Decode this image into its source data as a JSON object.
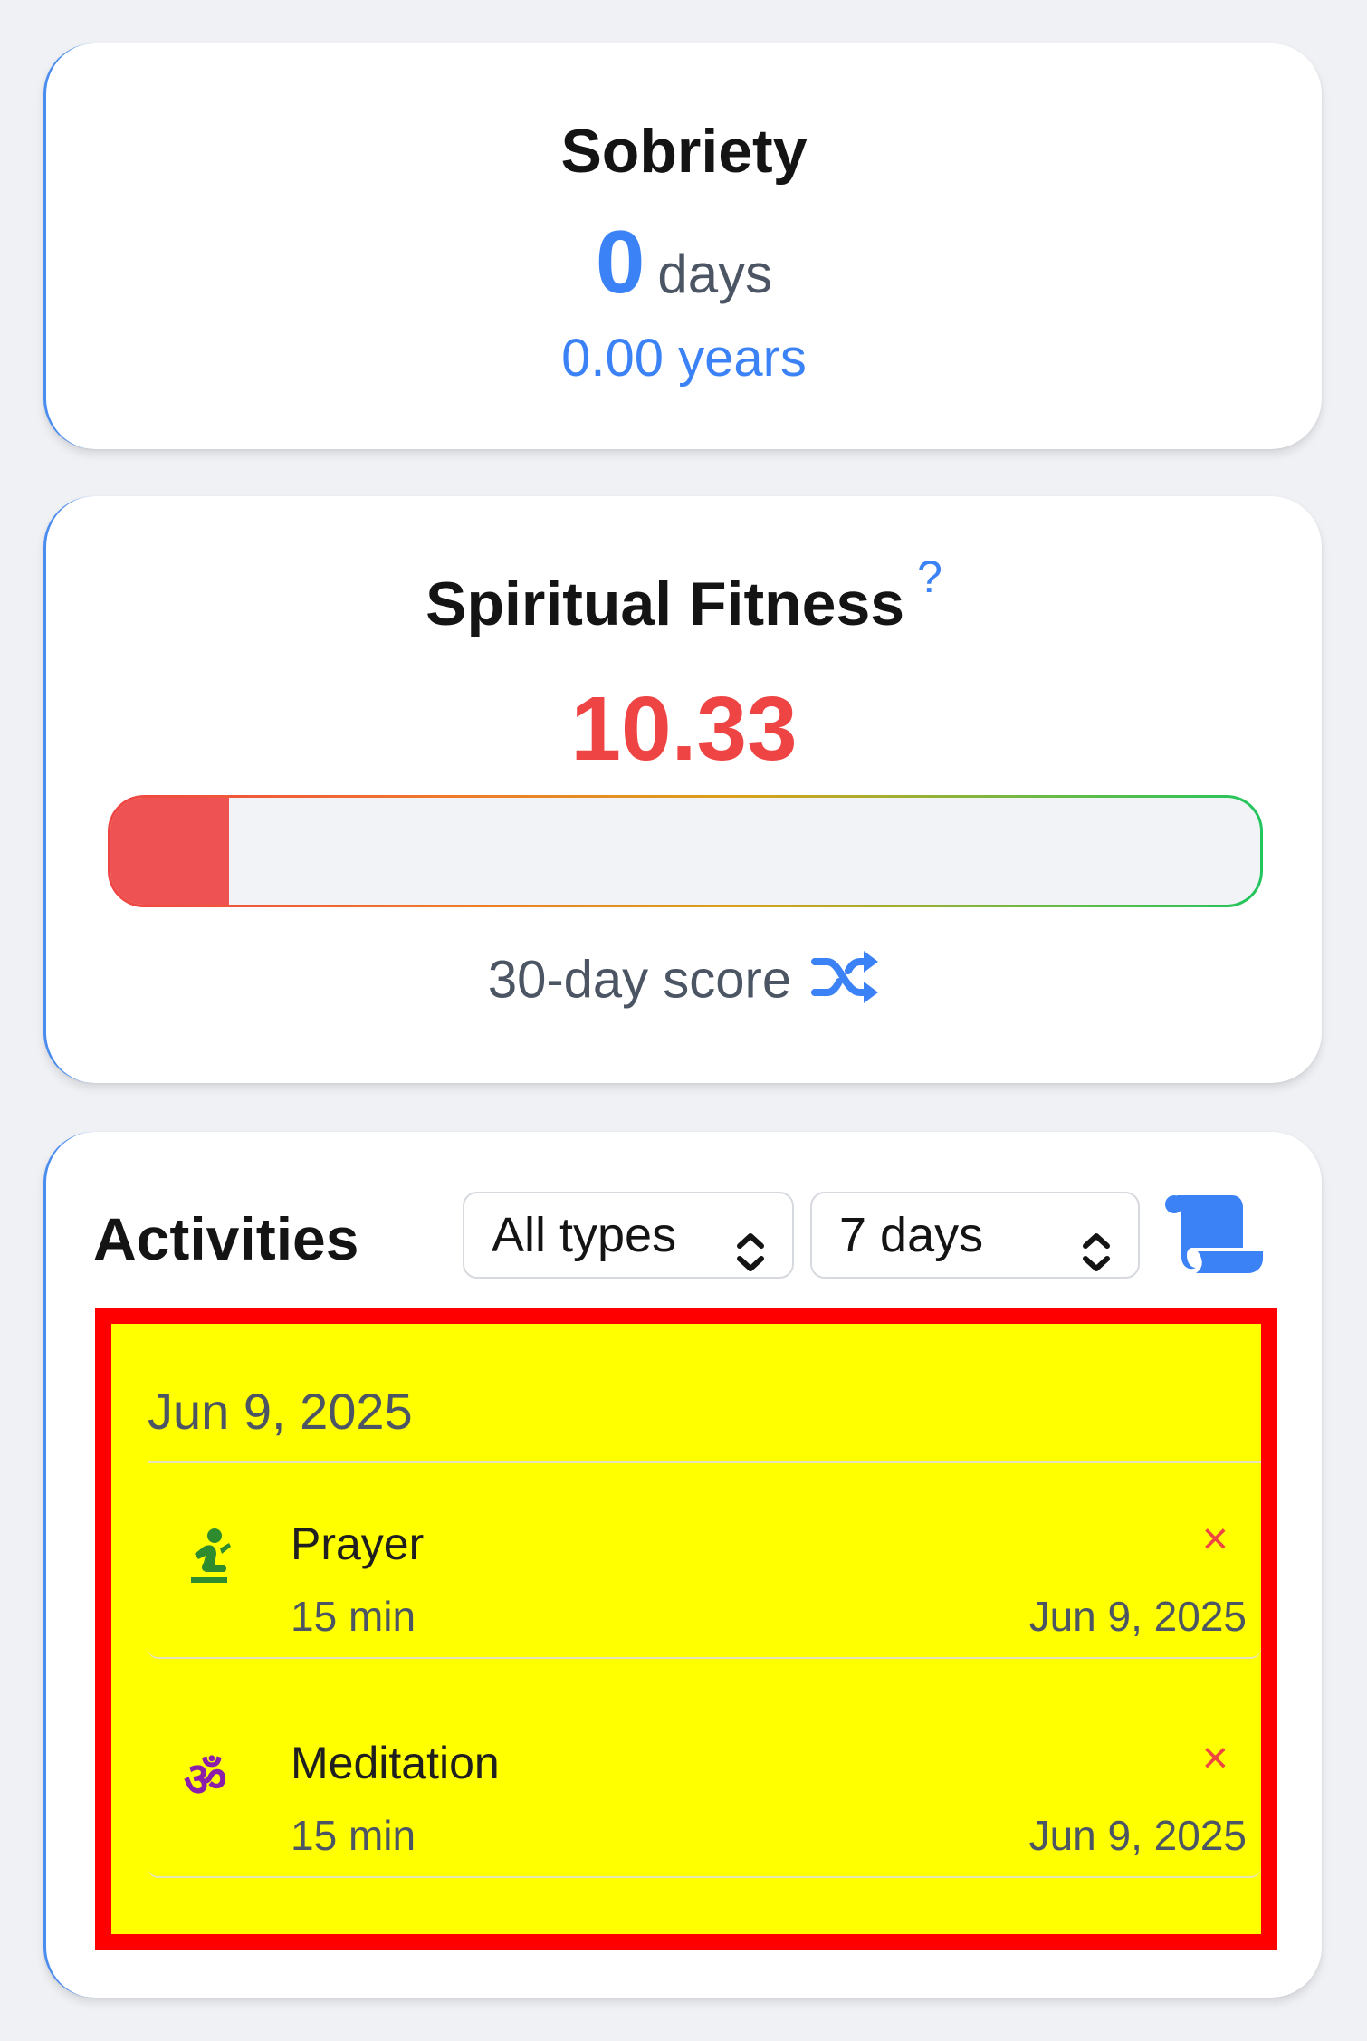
{
  "sobriety": {
    "title": "Sobriety",
    "days_value": "0",
    "days_unit": "days",
    "years_text": "0.00 years"
  },
  "spiritual_fitness": {
    "title": "Spiritual Fitness",
    "help_mark": "?",
    "score": "10.33",
    "score_fraction": 0.1033,
    "caption": "30-day score",
    "shuffle_icon": "shuffle-icon",
    "colors": {
      "score": "#ef4444",
      "bar_gradient_start": "#ef4444",
      "bar_gradient_end": "#22c55e"
    }
  },
  "activities": {
    "title": "Activities",
    "type_filter": "All types",
    "range_filter": "7 days",
    "log_icon": "scroll-icon",
    "groups": [
      {
        "date": "Jun 9, 2025",
        "entries": [
          {
            "icon": "person-praying-icon",
            "name": "Prayer",
            "duration": "15 min",
            "date": "Jun 9, 2025",
            "delete_label": "×"
          },
          {
            "icon": "om-icon",
            "name": "Meditation",
            "duration": "15 min",
            "date": "Jun 9, 2025",
            "delete_label": "×"
          }
        ]
      }
    ]
  },
  "accent_color": "#3b82f6"
}
